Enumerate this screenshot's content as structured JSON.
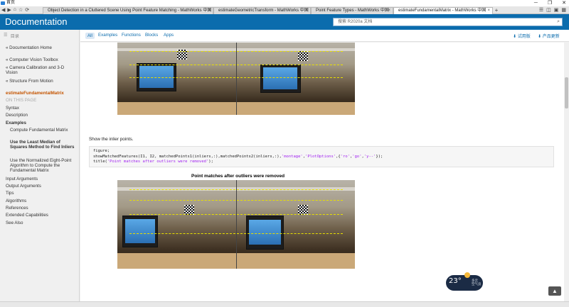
{
  "window": {
    "title": "首页",
    "controls": [
      "─",
      "❐",
      "✕"
    ]
  },
  "tabs": [
    {
      "label": "Object Detection in a Cluttered Scene Using Point Feature Matching - MathWorks 中国",
      "active": false
    },
    {
      "label": "estimateGeometricTransform - MathWorks 中国",
      "active": false
    },
    {
      "label": "Point Feature Types - MathWorks 中国",
      "active": false
    },
    {
      "label": "estimateFundamentalMatrix - MathWorks 中国",
      "active": true
    }
  ],
  "header": {
    "title": "Documentation",
    "search_placeholder": "搜索 R2020a 文档"
  },
  "filters": {
    "all": "All",
    "examples": "Examples",
    "functions": "Functions",
    "blocks": "Blocks",
    "apps": "Apps",
    "trial": "试用版",
    "updates": "产品更新"
  },
  "sidebar": {
    "toc": "目录",
    "items": [
      {
        "label": "« Documentation Home"
      },
      {
        "label": "« Computer Vision Toolbox"
      },
      {
        "label": "« Camera Calibration and 3-D Vision"
      },
      {
        "label": "« Structure From Motion"
      },
      {
        "label": "estimateFundamentalMatrix"
      },
      {
        "label": "ON THIS PAGE"
      },
      {
        "label": "Syntax"
      },
      {
        "label": "Description"
      },
      {
        "label": "Examples"
      },
      {
        "label": "Compute Fundamental Matrix"
      },
      {
        "label": "Use the Least Median of Squares Method to Find Inliers"
      },
      {
        "label": "Use the Normalized Eight-Point Algorithm to Compute the Fundamental Matrix"
      },
      {
        "label": "Input Arguments"
      },
      {
        "label": "Output Arguments"
      },
      {
        "label": "Tips"
      },
      {
        "label": "Algorithms"
      },
      {
        "label": "References"
      },
      {
        "label": "Extended Capabilities"
      },
      {
        "label": "See Also"
      }
    ]
  },
  "content": {
    "show_inliers": "Show the inlier points.",
    "code": {
      "line1": "figure;",
      "line2a": "showMatchedFeatures(I1, I2, matchedPoints1(inliers,:),matchedPoints2(inliers,:),",
      "line2b": "'montage'",
      "line2c": ",",
      "line2d": "'PlotOptions'",
      "line2e": ",{",
      "line2f": "'ro'",
      "line2g": ",",
      "line2h": "'go'",
      "line2i": ",",
      "line2j": "'y--'",
      "line2k": "});",
      "line3a": "title(",
      "line3b": "'Point matches after outliers were removed'",
      "line3c": ");"
    },
    "figure_title": "Point matches after outliers were removed"
  },
  "weather": {
    "temp": "23°",
    "line1": "多云",
    "line2": "空气良"
  },
  "totop": "▲"
}
